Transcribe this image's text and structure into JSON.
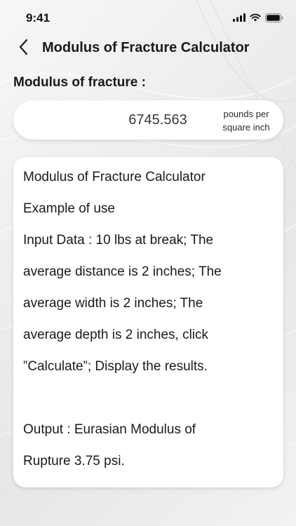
{
  "status_bar": {
    "time": "9:41",
    "icons": [
      "cellular-signal-icon",
      "wifi-icon",
      "battery-icon"
    ]
  },
  "header": {
    "back_icon": "chevron-left-icon",
    "title": "Modulus of Fracture Calculator"
  },
  "result": {
    "label": "Modulus of fracture :",
    "value": "6745.563",
    "unit_line1": "pounds per",
    "unit_line2": "square inch"
  },
  "info": {
    "lines": [
      "Modulus of Fracture Calculator",
      "Example of use",
      "Input Data : 10 lbs at break; The",
      "average distance is 2 inches; The",
      "average width is 2 inches; The",
      "average depth is 2 inches, click",
      "”Calculate”; Display the results.",
      "",
      "Output : Eurasian Modulus of",
      "Rupture 3.75 psi."
    ]
  },
  "colors": {
    "background": "#efefef",
    "card": "#ffffff",
    "text": "#1a1a1a"
  }
}
